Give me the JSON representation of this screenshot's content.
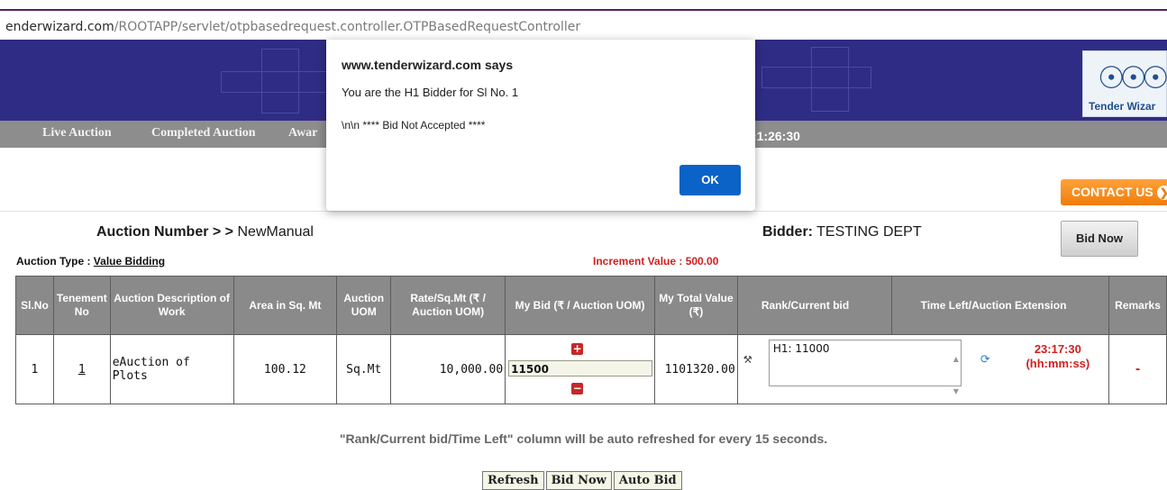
{
  "browser": {
    "url_host": "enderwizard.com",
    "url_path": "/ROOTAPP/servlet/otpbasedrequest.controller.OTPBasedRequestController"
  },
  "header": {
    "logo_text": "Tender Wizar"
  },
  "nav": {
    "items": [
      "Live Auction",
      "Completed Auction",
      "Awar"
    ],
    "time_fragment": ":1:26:30"
  },
  "contact_label": "CONTACT US",
  "auction": {
    "number_label": "Auction Number > >",
    "number_value": "NewManual",
    "bidder_label": "Bidder:",
    "bidder_value": "TESTING DEPT",
    "bid_now_label": "Bid Now",
    "type_label": "Auction Type :",
    "type_value": "Value Bidding",
    "increment": "Increment Value : 500.00"
  },
  "table": {
    "headers": [
      "Sl.No",
      "Tenement No",
      "Auction Description of Work",
      "Area in Sq. Mt",
      "Auction UOM",
      "Rate/Sq.Mt (₹ / Auction UOM)",
      "My Bid (₹ / Auction UOM)",
      "My Total Value (₹)",
      "Rank/Current bid",
      "Time Left/Auction Extension",
      "Remarks"
    ],
    "row": {
      "sl_no": "1",
      "tenement_no": "1",
      "description": "eAuction of Plots",
      "area": "100.12",
      "uom": "Sq.Mt",
      "rate": "10,000.00",
      "my_bid": "11500",
      "total_value": "1101320.00",
      "rank_text": "H1: 11000",
      "time_left": "23:17:30",
      "time_unit": "(hh:mm:ss)",
      "remarks": "-"
    }
  },
  "note": "\"Rank/Current bid/Time Left\" column will be auto refreshed for every 15 seconds.",
  "buttons": {
    "refresh": "Refresh",
    "bid_now": "Bid Now",
    "auto_bid": "Auto Bid"
  },
  "dialog": {
    "title": "www.tenderwizard.com says",
    "line1": "You are the H1 Bidder for Sl No. 1",
    "line2": "\\n\\n **** Bid Not Accepted ****",
    "ok_label": "OK"
  },
  "colors": {
    "banner": "#2f2c85",
    "navbar": "#8d8d8d",
    "accent_red": "#d01f1f",
    "ok_blue": "#0b63c7",
    "contact_orange": "#f07d0b"
  }
}
